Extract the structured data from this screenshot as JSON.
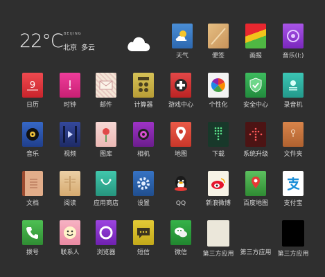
{
  "weather": {
    "temperature": "22°C",
    "city_en": "BEIJING",
    "city": "北京",
    "condition": "多云",
    "icon": "cloud-icon"
  },
  "apps": [
    {
      "label": "天气",
      "icon": "weather-icon",
      "color": "#3a7fc9"
    },
    {
      "label": "便签",
      "icon": "notes-icon",
      "color": "#d8a86a"
    },
    {
      "label": "画报",
      "icon": "magazine-icon",
      "color": "#e53a3a"
    },
    {
      "label": "音乐(I:)",
      "icon": "music-icon",
      "color": "#8f3fd0"
    },
    {
      "label": "日历",
      "icon": "calendar-icon",
      "color": "#e0343d"
    },
    {
      "label": "时钟",
      "icon": "clock-icon",
      "color": "#e0238a"
    },
    {
      "label": "邮件",
      "icon": "mail-icon",
      "color": "#efe1d2"
    },
    {
      "label": "计算器",
      "icon": "calculator-icon",
      "color": "#c9b249"
    },
    {
      "label": "游戏中心",
      "icon": "game-icon",
      "color": "#d93b3b"
    },
    {
      "label": "个性化",
      "icon": "theme-icon",
      "color": "#f2f2f2"
    },
    {
      "label": "安全中心",
      "icon": "security-icon",
      "color": "#2fa84e"
    },
    {
      "label": "录音机",
      "icon": "recorder-icon",
      "color": "#2fb3a3"
    },
    {
      "label": "音乐",
      "icon": "music-player-icon",
      "color": "#2c57b3"
    },
    {
      "label": "视频",
      "icon": "video-icon",
      "color": "#2b3c86"
    },
    {
      "label": "图库",
      "icon": "gallery-icon",
      "color": "#f0c4c4"
    },
    {
      "label": "相机",
      "icon": "camera-icon",
      "color": "#8a2ab0"
    },
    {
      "label": "地图",
      "icon": "map-icon",
      "color": "#e2493a"
    },
    {
      "label": "下载",
      "icon": "download-icon",
      "color": "#1c3d2c"
    },
    {
      "label": "系统升级",
      "icon": "update-icon",
      "color": "#5a1a1a"
    },
    {
      "label": "文件夹",
      "icon": "folder-icon",
      "color": "#c7723c"
    },
    {
      "label": "文档",
      "icon": "document-icon",
      "color": "#d69a74"
    },
    {
      "label": "阅读",
      "icon": "reader-icon",
      "color": "#e7c599"
    },
    {
      "label": "应用商店",
      "icon": "store-icon",
      "color": "#35b69d"
    },
    {
      "label": "设置",
      "icon": "settings-icon",
      "color": "#2c5ea8"
    },
    {
      "label": "QQ",
      "icon": "qq-icon",
      "color": "#ffffff"
    },
    {
      "label": "新浪微博",
      "icon": "weibo-icon",
      "color": "#f6f1e1"
    },
    {
      "label": "百度地图",
      "icon": "baidu-map-icon",
      "color": "#4caf50"
    },
    {
      "label": "支付宝",
      "icon": "alipay-icon",
      "color": "#ffffff"
    },
    {
      "label": "拨号",
      "icon": "phone-icon",
      "color": "#43b047"
    },
    {
      "label": "联系人",
      "icon": "contacts-icon",
      "color": "#f4a1b6"
    },
    {
      "label": "浏览器",
      "icon": "browser-icon",
      "color": "#8a2fd0"
    },
    {
      "label": "短信",
      "icon": "message-icon",
      "color": "#d8c02b"
    },
    {
      "label": "微信",
      "icon": "wechat-icon",
      "color": "#2a9d3c"
    },
    {
      "label": "第三方应用",
      "icon": "third-party-app-icon",
      "color": "#e8e4d7"
    },
    {
      "label": "第三方应用",
      "icon": "third-party-app-icon",
      "color": "#2f2f2f"
    },
    {
      "label": "第三方应用",
      "icon": "third-party-app-icon",
      "color": "#000000"
    }
  ]
}
